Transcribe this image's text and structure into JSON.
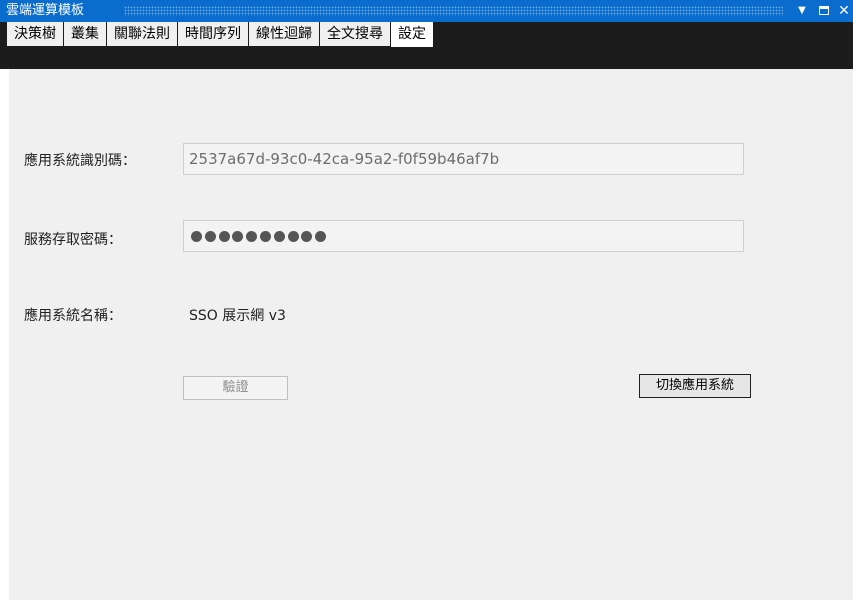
{
  "window": {
    "title": "雲端運算模板",
    "controls": [
      "chevron-down-icon",
      "maximize-icon",
      "close-icon"
    ]
  },
  "tabs": [
    {
      "label": "決策樹",
      "active": false
    },
    {
      "label": "叢集",
      "active": false
    },
    {
      "label": "關聯法則",
      "active": false
    },
    {
      "label": "時間序列",
      "active": false
    },
    {
      "label": "線性迴歸",
      "active": false
    },
    {
      "label": "全文搜尋",
      "active": false
    },
    {
      "label": "設定",
      "active": true
    }
  ],
  "settings": {
    "app_id_label": "應用系統識別碼：",
    "app_id_value": "2537a67d-93c0-42ca-95a2-f0f59b46af7b",
    "password_label": "服務存取密碼：",
    "password_mask_count": 10,
    "app_name_label": "應用系統名稱：",
    "app_name_value": "SSO 展示網 v3",
    "verify_button": "驗證",
    "switch_button": "切換應用系統"
  },
  "colors": {
    "titlebar": "#0a6dcd",
    "tabstrip": "#1c1c1c",
    "panel": "#f0f0f0"
  }
}
